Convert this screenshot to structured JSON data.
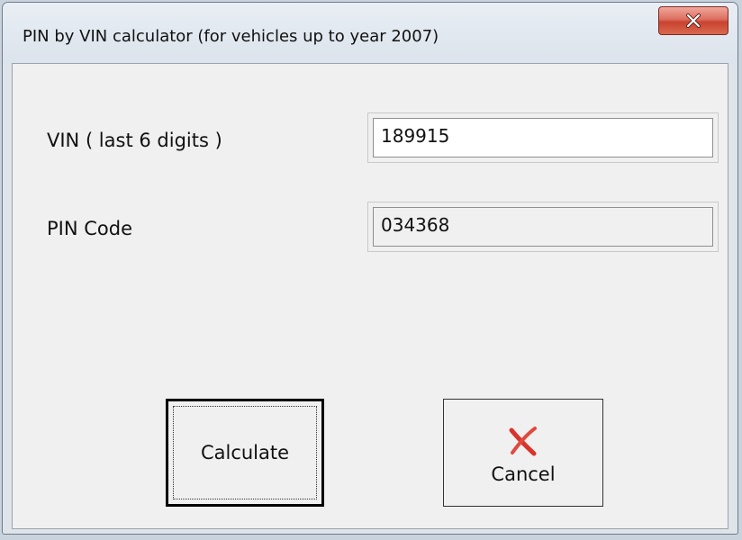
{
  "window": {
    "title": "PIN by VIN calculator (for vehicles up to year 2007)",
    "close_icon": "close-x-icon"
  },
  "form": {
    "vin_label": "VIN ( last 6 digits )",
    "vin_value": "189915",
    "pin_label": "PIN Code",
    "pin_value": "034368"
  },
  "buttons": {
    "calculate_label": "Calculate",
    "cancel_label": "Cancel",
    "cancel_icon": "red-x-cancel-icon"
  },
  "colors": {
    "close_button": "#c8432f",
    "cancel_icon": "#d9342b"
  }
}
